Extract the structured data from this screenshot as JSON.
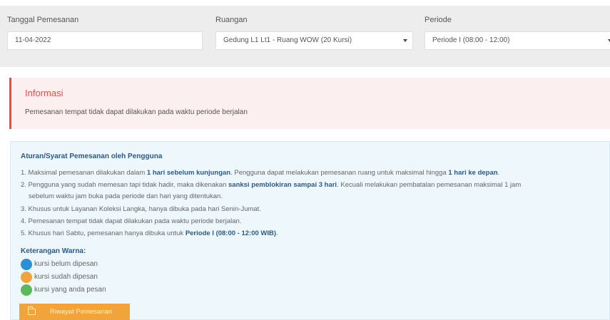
{
  "filters": {
    "date": {
      "label": "Tanggal Pemesanan",
      "value": "11-04-2022"
    },
    "room": {
      "label": "Ruangan",
      "value": "Gedung L1 Lt1 - Ruang WOW (20 Kursi)"
    },
    "period": {
      "label": "Periode",
      "value": "Periode I (08:00 - 12:00)"
    }
  },
  "info": {
    "title": "Informasi",
    "message": "Pemesanan tempat tidak dapat dilakukan pada waktu periode berjalan"
  },
  "rules": {
    "title": "Aturan/Syarat Pemesanan oleh Pengguna",
    "items": [
      {
        "p1": "1. Maksimal pemesanan dilakukan dalam ",
        "b1": "1 hari sebelum kunjungan",
        "p2": ". Pengguna dapat melakukan pemesanan ruang untuk maksimal hingga ",
        "b2": "1 hari ke depan",
        "p3": "."
      },
      {
        "p1": "2. Pengguna yang sudah memesan tapi tidak hadir, maka dikenakan ",
        "b1": "sanksi pemblokiran sampai 3 hari",
        "p2": ". Kecuali melakukan pembatalan pemesanan maksimal 1 jam",
        "p3": "sebelum waktu jam buka pada periode dan hari yang ditentukan."
      },
      {
        "text": "3. Khusus untuk Layanan Koleksi Langka, hanya dibuka pada hari Senin-Jumat."
      },
      {
        "text": "4. Pemesanan tempat tidak dapat dilakukan pada waktu periode berjalan."
      },
      {
        "p1": "5. Khusus hari Sabtu, pemesanan hanya dibuka untuk ",
        "b1": "Periode I (08:00 - 12:00 WIB)",
        "p2": "."
      }
    ]
  },
  "legend": {
    "title": "Keterangan Warna:",
    "items": [
      {
        "label": "kursi belum dipesan",
        "color": "#2a8fd6"
      },
      {
        "label": "kursi sudah dipesan",
        "color": "#f0a43a"
      },
      {
        "label": "kursi yang anda pesan",
        "color": "#5cb85c"
      }
    ]
  },
  "history_button": {
    "label": "Riwayat Pemesanan",
    "icon": "folder-open-icon",
    "color": "#f0a43a"
  }
}
